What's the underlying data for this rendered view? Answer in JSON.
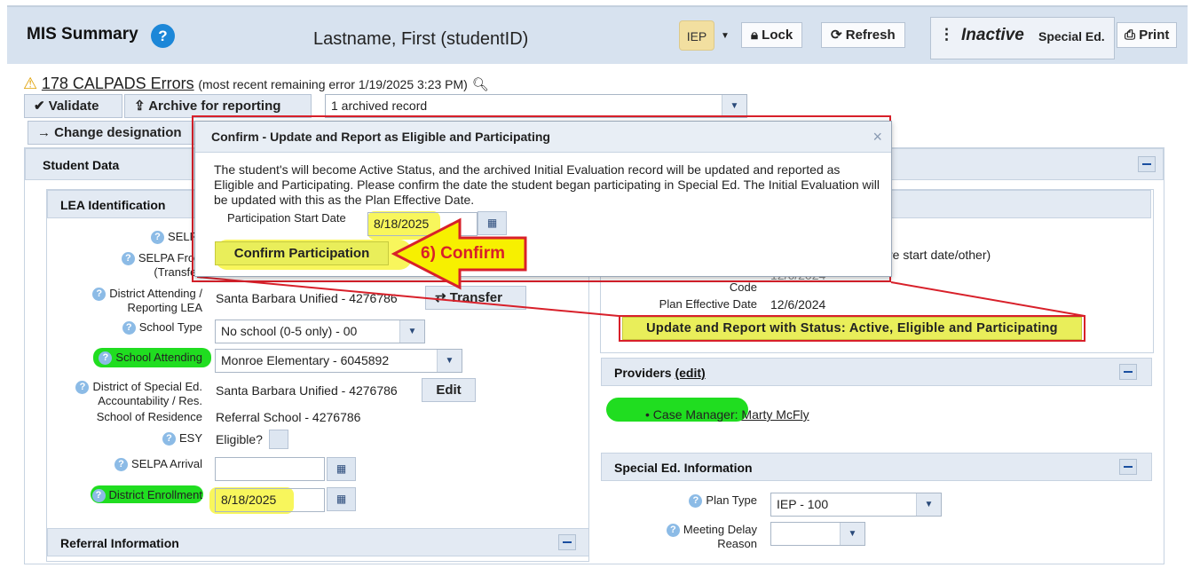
{
  "header": {
    "title": "MIS Summary",
    "help": "?",
    "student": "Lastname, First (studentID)",
    "iep_badge": "IEP",
    "lock": "Lock",
    "refresh": "Refresh",
    "status": "Inactive",
    "program": "Special Ed.",
    "print": "Print"
  },
  "errors": {
    "link": "178 CALPADS Errors",
    "note": "(most recent remaining error 1/19/2025 3:23 PM)"
  },
  "toolbar": {
    "validate": "Validate",
    "archive": "Archive for reporting",
    "archive_select": "1 archived record",
    "change": "Change designation"
  },
  "student_data": {
    "title": "Student Data",
    "lea": {
      "title": "LEA Identification",
      "selpa_label": "SELPA",
      "selpa_from_label1": "SELPA From",
      "selpa_from_label2": "(Transfer)",
      "district_attending_label1": "District Attending /",
      "district_attending_label2": "Reporting LEA",
      "district_attending_value": "Santa Barbara Unified - 4276786",
      "transfer": "Transfer",
      "school_type_label": "School Type",
      "school_type_value": "No school (0-5 only) - 00",
      "school_attending_label": "School Attending",
      "school_attending_value": "Monroe Elementary - 6045892",
      "district_sped_label1": "District of Special Ed.",
      "district_sped_label2": "Accountability / Res.",
      "district_sped_value": "Santa Barbara Unified - 4276786",
      "edit": "Edit",
      "school_residence_label": "School of Residence",
      "school_residence_value": "Referral School - 4276786",
      "esy_label": "ESY",
      "esy_value": "Eligible?",
      "selpa_arrival_label": "SELPA Arrival",
      "district_enrollment_label": "District Enrollment",
      "district_enrollment_value": "8/18/2025"
    },
    "referral_title": "Referral Information"
  },
  "right": {
    "partial1": "r",
    "partial2": "re start date/other)",
    "code_label": "Code",
    "code_value": "12/6/2024",
    "plan_effective_label": "Plan Effective Date",
    "plan_effective_value": "12/6/2024",
    "update_button": "Update and Report with Status: Active, Eligible and Participating",
    "providers_title": "Providers",
    "providers_edit": "(edit)",
    "case_manager_label": "Case Manager:",
    "case_manager_name": "Marty McFly",
    "sped_info_title": "Special Ed. Information",
    "plan_type_label": "Plan Type",
    "plan_type_value": "IEP - 100",
    "meeting_delay_label1": "Meeting Delay",
    "meeting_delay_label2": "Reason"
  },
  "modal": {
    "title": "Confirm - Update and Report as Eligible and Participating",
    "close": "×",
    "text": "The student's will become Active Status, and the archived Initial Evaluation record will be updated and reported as Eligible and Participating. Please confirm the date the student began participating in Special Ed. The Initial Evaluation will be updated with this as the Plan Effective Date.",
    "date_label": "Participation Start Date",
    "date_value": "8/18/2025",
    "confirm_button": "Confirm Participation"
  },
  "callout": {
    "text": "6) Confirm"
  },
  "colors": {
    "annotation_red": "#d8202a",
    "highlight_yellow": "#f7f54a",
    "highlight_green": "#20dd20",
    "help_blue": "#1c87d8"
  }
}
